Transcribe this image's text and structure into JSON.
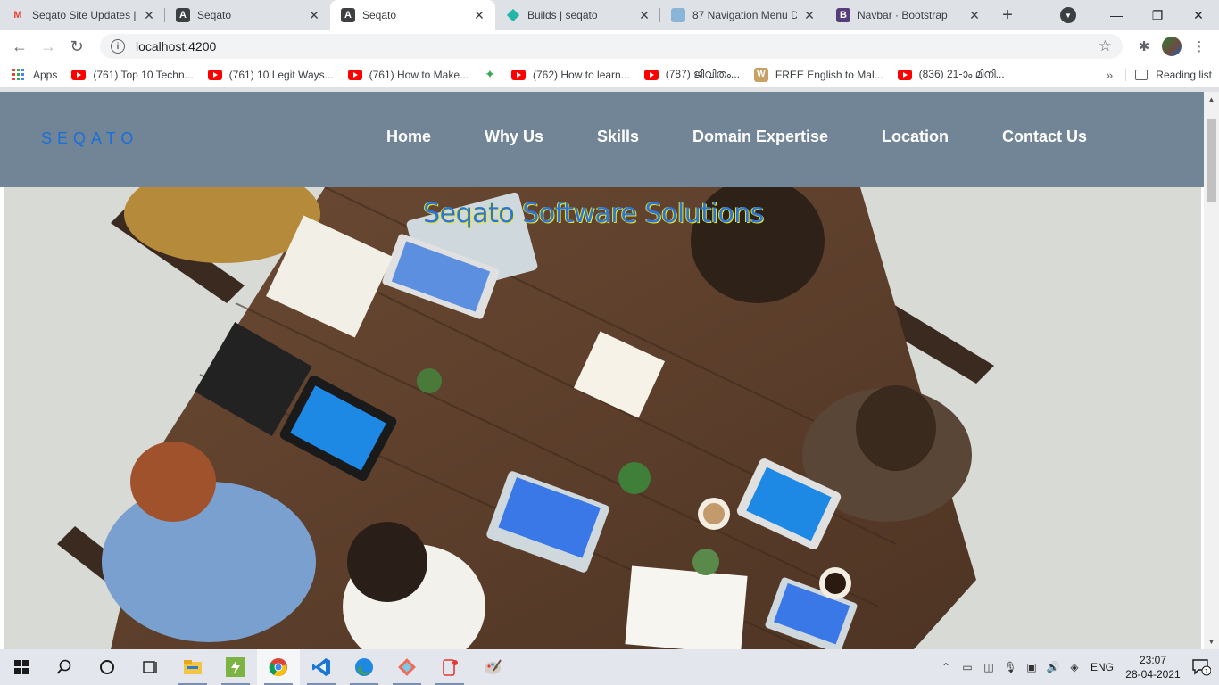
{
  "browser": {
    "tabs": [
      {
        "title": "Seqato Site Updates | ..",
        "icon": "gmail-icon",
        "active": false
      },
      {
        "title": "Seqato",
        "icon": "angular-icon",
        "active": false
      },
      {
        "title": "Seqato",
        "icon": "angular-icon",
        "active": true
      },
      {
        "title": "Builds | seqato",
        "icon": "diamond-icon",
        "active": false
      },
      {
        "title": "87 Navigation Menu D..",
        "icon": "image-icon",
        "active": false
      },
      {
        "title": "Navbar · Bootstrap",
        "icon": "bootstrap-icon",
        "active": false
      }
    ],
    "url": "localhost:4200",
    "bookmarks": [
      {
        "label": "Apps",
        "icon": "apps-icon"
      },
      {
        "label": "(761) Top 10 Techn...",
        "icon": "youtube-icon"
      },
      {
        "label": "(761) 10 Legit Ways...",
        "icon": "youtube-icon"
      },
      {
        "label": "(761) How to Make...",
        "icon": "youtube-icon"
      },
      {
        "label": "",
        "icon": "google-sparkle-icon"
      },
      {
        "label": "(762) How to learn...",
        "icon": "youtube-icon"
      },
      {
        "label": "(787) ജീവിതം...",
        "icon": "youtube-icon"
      },
      {
        "label": "FREE English to Mal...",
        "icon": "w-icon"
      },
      {
        "label": "(836) 21-ാം മിനി...",
        "icon": "youtube-icon"
      }
    ],
    "more": "»",
    "reading_list": "Reading list"
  },
  "site": {
    "brand": "SEQATO",
    "nav": [
      "Home",
      "Why Us",
      "Skills",
      "Domain Expertise",
      "Location",
      "Contact Us"
    ],
    "hero_title": "Seqato Software Solutions"
  },
  "taskbar": {
    "apps": [
      "windows-start-icon",
      "search-icon",
      "cortana-icon",
      "task-view-icon",
      "file-explorer-icon",
      "app-green-icon",
      "chrome-icon",
      "vscode-icon",
      "edge-icon",
      "git-icon",
      "app-red-icon",
      "paint-icon"
    ],
    "lang": "ENG",
    "time": "23:07",
    "date": "28-04-2021",
    "notifications": "1"
  },
  "colors": {
    "nav_bg": "#718596",
    "brand": "#1a6fd8",
    "hero_title": "#2b74d9",
    "hero_title_shadow": "#e6e62a"
  }
}
